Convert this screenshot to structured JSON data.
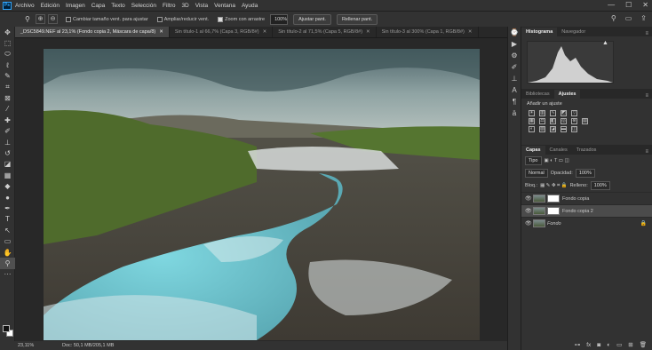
{
  "app": {
    "logo": "Ps"
  },
  "menu": [
    "Archivo",
    "Edición",
    "Imagen",
    "Capa",
    "Texto",
    "Selección",
    "Filtro",
    "3D",
    "Vista",
    "Ventana",
    "Ayuda"
  ],
  "window_controls": [
    "—",
    "☐",
    "✕"
  ],
  "options": {
    "resize_label": "Cambiar tamaño vent. para ajustar",
    "zoom_all_label": "Ampliar/reducir vent.",
    "scrubby_label": "Zoom con arrastre",
    "zoom_value": "100%",
    "fit_button": "Ajustar pant.",
    "fill_button": "Rellenar pant."
  },
  "tabs": [
    {
      "label": "_DSC5849.NEF al 23,1% (Fondo copia 2, Máscara de capa/8)",
      "close": "✕",
      "active": true
    },
    {
      "label": "Sin título-1 al 66,7% (Capa 3, RGB/8#)",
      "close": "✕",
      "active": false
    },
    {
      "label": "Sin título-2 al 71,5% (Capa 5, RGB/8#)",
      "close": "✕",
      "active": false
    },
    {
      "label": "Sin título-3 al 300% (Capa 1, RGB/8#)",
      "close": "✕",
      "active": false
    }
  ],
  "status": {
    "zoom": "23,11%",
    "doc": "Doc: 50,1 MB/205,1 MB"
  },
  "panels": {
    "histogram_tabs": [
      "Histograma",
      "Navegador"
    ],
    "adjust_tabs": [
      "Bibliotecas",
      "Ajustes"
    ],
    "add_adjustment": "Añadir un ajuste",
    "layers_tabs": [
      "Capas",
      "Canales",
      "Trazados"
    ],
    "kind": "Tipo",
    "blend": "Normal",
    "opacity_label": "Opacidad:",
    "opacity": "100%",
    "lock_label": "Bloq.:",
    "fill_label": "Relleno:",
    "fill": "100%",
    "layers": [
      {
        "name": "Fondo copia",
        "selected": false
      },
      {
        "name": "Fondo copia 2",
        "selected": true
      },
      {
        "name": "Fondo",
        "selected": false
      }
    ]
  },
  "colors": {
    "accent": "#31a8ff",
    "water": "#5fc8d6"
  }
}
